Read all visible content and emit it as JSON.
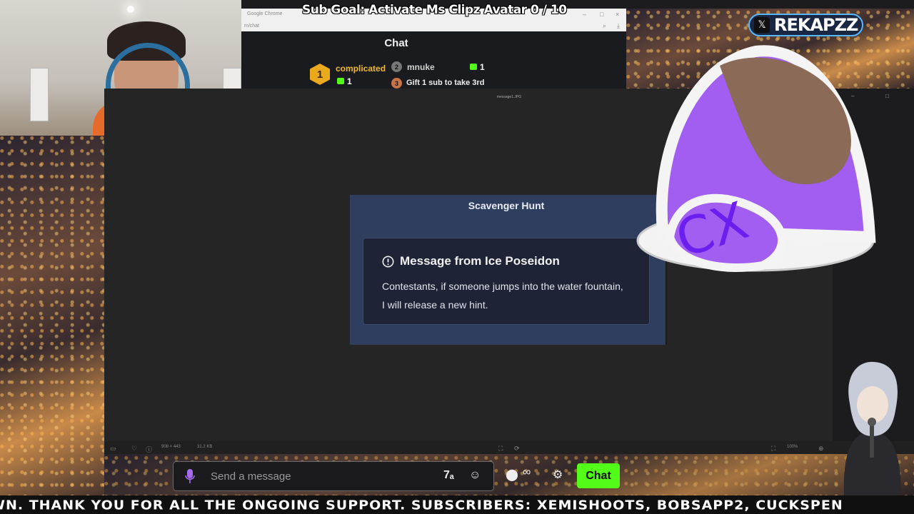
{
  "stream_overlay": {
    "sub_goal": "Sub Goal: Activate Ms Clipz Avatar  0 / 10",
    "twitter_handle": "REKAPZZ",
    "ticker": "WN. THANK YOU FOR ALL THE ONGOING SUPPORT. SUBSCRIBERS: XEMISHOOTS, BOBSAPP2, CUCKSPEN"
  },
  "browser": {
    "tab_title": "Google Chrome",
    "url_fragment": "m/chat"
  },
  "leaderboard": {
    "title": "Chat",
    "entries": [
      {
        "rank": "1",
        "name": "complicated",
        "count": "1"
      },
      {
        "rank": "2",
        "name": "mnuke",
        "count": "1"
      },
      {
        "rank": "3",
        "name": "Gift 1 sub to take 3rd",
        "count": ""
      }
    ]
  },
  "image_viewer": {
    "filename": "message1.JPG",
    "dimensions": "908 × 443",
    "file_size": "31.2 KB",
    "zoom": "100%"
  },
  "modal": {
    "title": "Scavenger Hunt",
    "heading": "Message from Ice Poseidon",
    "body": "Contestants, if someone jumps into the water fountain, I will release a new hint.",
    "icon": "alert-circle-icon"
  },
  "hat_emote": {
    "label": "CX"
  },
  "chat_bar": {
    "placeholder": "Send a message",
    "send_label": "Chat",
    "accent": "#53fc18"
  }
}
